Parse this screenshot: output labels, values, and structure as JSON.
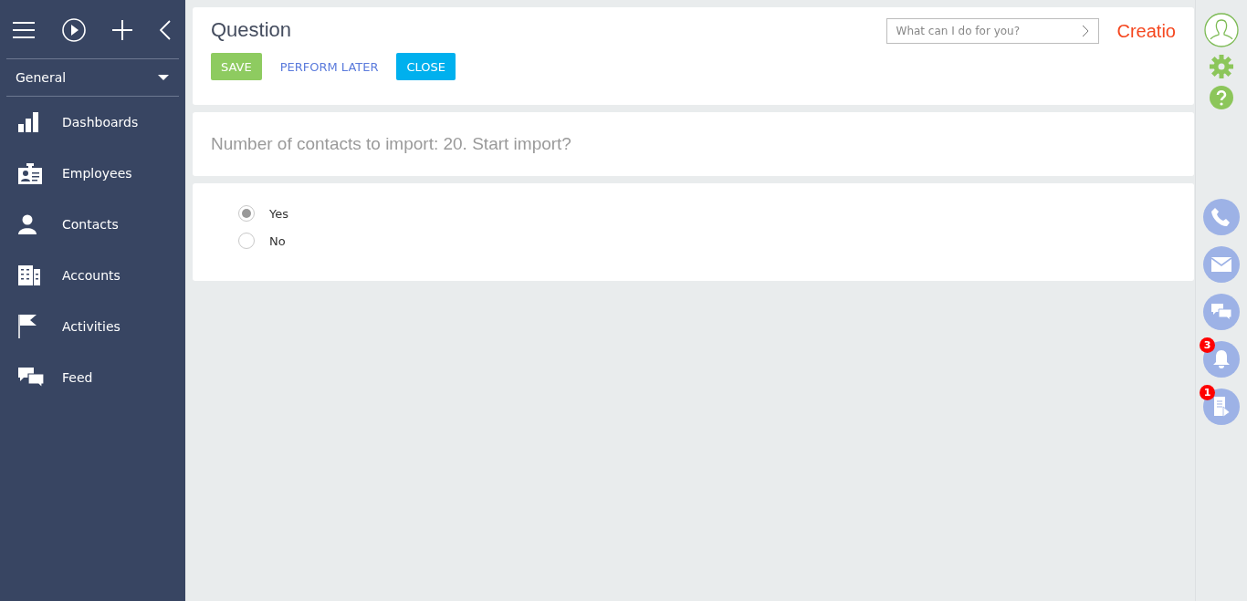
{
  "sidebar": {
    "workplace": "General",
    "items": [
      {
        "label": "Dashboards",
        "selected": false
      },
      {
        "label": "Employees",
        "selected": false
      },
      {
        "label": "Contacts",
        "selected": false
      },
      {
        "label": "Accounts",
        "selected": false
      },
      {
        "label": "Activities",
        "selected": false
      },
      {
        "label": "Feed",
        "selected": false
      }
    ]
  },
  "header": {
    "title": "Question",
    "buttons": [
      {
        "label": "SAVE",
        "kind": "primary"
      },
      {
        "label": "PERFORM LATER",
        "kind": "link"
      },
      {
        "label": "CLOSE",
        "kind": "accent"
      }
    ],
    "search": {
      "placeholder": "What can I do for you?"
    },
    "logo": "Creatio"
  },
  "question": "Number of contacts to import: 20. Start import?",
  "options": [
    {
      "label": "Yes",
      "selected": true
    },
    {
      "label": "No",
      "selected": false
    }
  ],
  "rail": {
    "notifications_badge": "3",
    "tasks_badge": "1"
  }
}
